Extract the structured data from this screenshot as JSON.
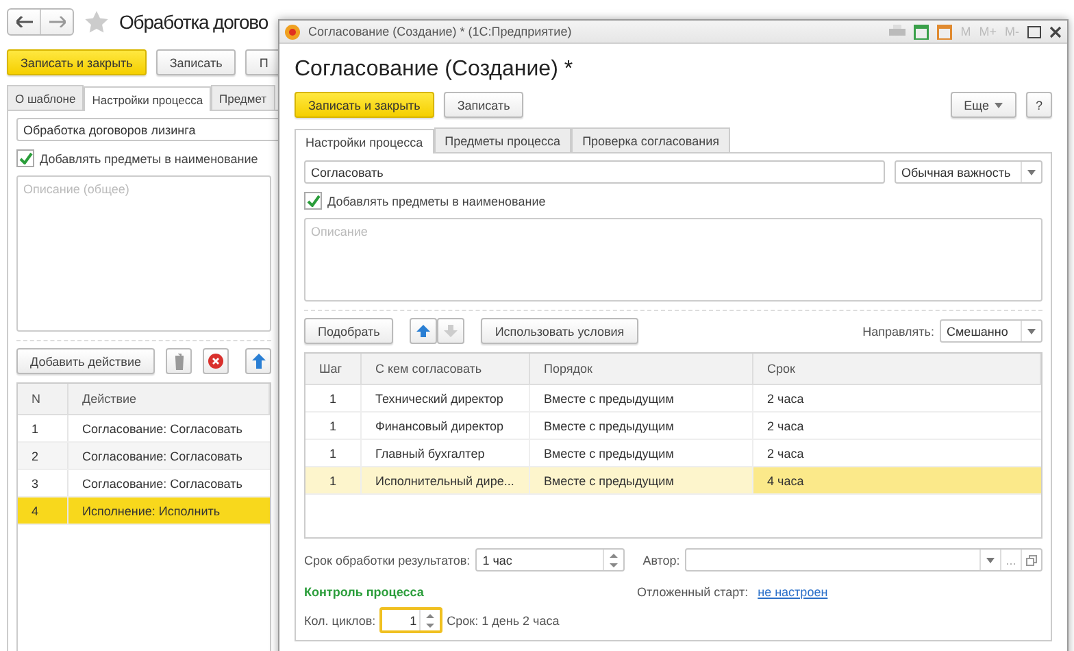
{
  "background_window": {
    "title": "Обработка догово",
    "buttons": [
      {
        "label": "Записать и закрыть",
        "kind": "primary"
      },
      {
        "label": "Записать",
        "kind": "default"
      },
      {
        "label": "П",
        "kind": "default"
      }
    ],
    "tabs": [
      {
        "label": "О шаблоне",
        "selected": false
      },
      {
        "label": "Настройки процесса",
        "selected": true
      },
      {
        "label": "Предмет",
        "selected": false
      }
    ],
    "name_field": {
      "value": "Обработка договоров лизинга"
    },
    "add_subjects": {
      "label": "Добавлять предметы в наименование",
      "checked": true
    },
    "description": {
      "placeholder": "Описание (общее)"
    },
    "add_action_button": "Добавить действие",
    "table": {
      "columns": [
        "N",
        "Действие"
      ],
      "rows": [
        {
          "n": "1",
          "action": "Согласование: Согласовать",
          "selected": false
        },
        {
          "n": "2",
          "action": "Согласование: Согласовать",
          "selected": false
        },
        {
          "n": "3",
          "action": "Согласование: Согласовать",
          "selected": false
        },
        {
          "n": "4",
          "action": "Исполнение: Исполнить",
          "selected": true
        }
      ]
    }
  },
  "dialog": {
    "window_title": "Согласование (Создание) *  (1С:Предприятие)",
    "memory_buttons": [
      "M",
      "M+",
      "M-"
    ],
    "title": "Согласование (Создание) *",
    "buttons": [
      {
        "label": "Записать и закрыть",
        "kind": "primary"
      },
      {
        "label": "Записать",
        "kind": "default"
      }
    ],
    "more_button": "Еще",
    "help_button": "?",
    "tabs": [
      {
        "label": "Настройки процесса",
        "selected": true
      },
      {
        "label": "Предметы процесса",
        "selected": false
      },
      {
        "label": "Проверка согласования",
        "selected": false
      }
    ],
    "subject_field": {
      "value": "Согласовать"
    },
    "importance": {
      "value": "Обычная важность"
    },
    "add_subjects": {
      "label": "Добавлять предметы в наименование",
      "checked": true
    },
    "description": {
      "placeholder": "Описание"
    },
    "pick_button": "Подобрать",
    "conditions_button": "Использовать условия",
    "route": {
      "label": "Направлять:",
      "value": "Смешанно"
    },
    "table": {
      "columns": [
        "Шаг",
        "С кем согласовать",
        "Порядок",
        "Срок"
      ],
      "rows": [
        {
          "step": "1",
          "who": "Технический директор",
          "order": "Вместе с предыдущим",
          "term": "2 часа",
          "selected": false
        },
        {
          "step": "1",
          "who": "Финансовый директор",
          "order": "Вместе с предыдущим",
          "term": "2 часа",
          "selected": false
        },
        {
          "step": "1",
          "who": "Главный бухгалтер",
          "order": "Вместе с предыдущим",
          "term": "2 часа",
          "selected": false
        },
        {
          "step": "1",
          "who": "Исполнительный дире...",
          "order": "Вместе с предыдущим",
          "term": "4 часа",
          "selected": true
        }
      ]
    },
    "processing_term": {
      "label": "Срок обработки результатов:",
      "value": "1 час"
    },
    "author": {
      "label": "Автор:",
      "select_button": "..."
    },
    "section_title": "Контроль процесса",
    "deferred_start": {
      "label": "Отложенный старт:",
      "link": "не настроен"
    },
    "cycles": {
      "label": "Кол. циклов:",
      "value": "1",
      "focused": true
    },
    "term_text": "Срок: 1 день 2 часа"
  }
}
